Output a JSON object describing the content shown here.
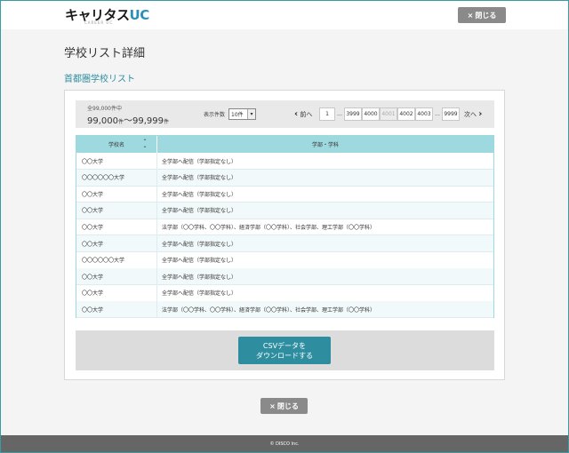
{
  "header": {
    "logo_main": "キャリタス",
    "logo_accent": "UC",
    "logo_sub": "CAREER UC",
    "close_icon": "×",
    "close_label": "閉じる"
  },
  "page": {
    "title": "学校リスト詳細",
    "section_title": "首都圏学校リスト"
  },
  "toolbar": {
    "total_label": "全99,000件中",
    "range_start": "99,000",
    "range_start_unit": "件",
    "range_sep": "～",
    "range_end": "99,999",
    "range_end_unit": "件",
    "perpage_label": "表示件数",
    "perpage_value": "10件",
    "prev_label": "前へ",
    "next_label": "次へ",
    "pages": [
      "1",
      "…",
      "3999",
      "4000",
      "4001",
      "4002",
      "4003",
      "…",
      "9999"
    ],
    "active_page": "4001"
  },
  "table": {
    "col_school": "学校名",
    "col_faculty": "学部・学科",
    "rows": [
      {
        "school": "〇〇大学",
        "faculty": "全学部へ配信（学部指定なし）"
      },
      {
        "school": "〇〇〇〇〇〇大学",
        "faculty": "全学部へ配信（学部指定なし）"
      },
      {
        "school": "〇〇大学",
        "faculty": "全学部へ配信（学部指定なし）"
      },
      {
        "school": "〇〇大学",
        "faculty": "全学部へ配信（学部指定なし）"
      },
      {
        "school": "〇〇大学",
        "faculty": "法学部（〇〇学科、〇〇学科）、経済学部（〇〇学科）、社会学部、理工学部（〇〇学科）"
      },
      {
        "school": "〇〇大学",
        "faculty": "全学部へ配信（学部指定なし）"
      },
      {
        "school": "〇〇〇〇〇〇大学",
        "faculty": "全学部へ配信（学部指定なし）"
      },
      {
        "school": "〇〇大学",
        "faculty": "全学部へ配信（学部指定なし）"
      },
      {
        "school": "〇〇大学",
        "faculty": "全学部へ配信（学部指定なし）"
      },
      {
        "school": "〇〇大学",
        "faculty": "法学部（〇〇学科、〇〇学科）、経済学部（〇〇学科）、社会学部、理工学部（〇〇学科）"
      }
    ]
  },
  "csv": {
    "line1": "CSVデータを",
    "line2": "ダウンロードする"
  },
  "footer": {
    "copyright": "© DISCO Inc."
  },
  "colors": {
    "accent": "#2e8ea0",
    "table_header": "#9fd9e0",
    "button_gray": "#8a8a8a",
    "footer_bg": "#666666"
  }
}
